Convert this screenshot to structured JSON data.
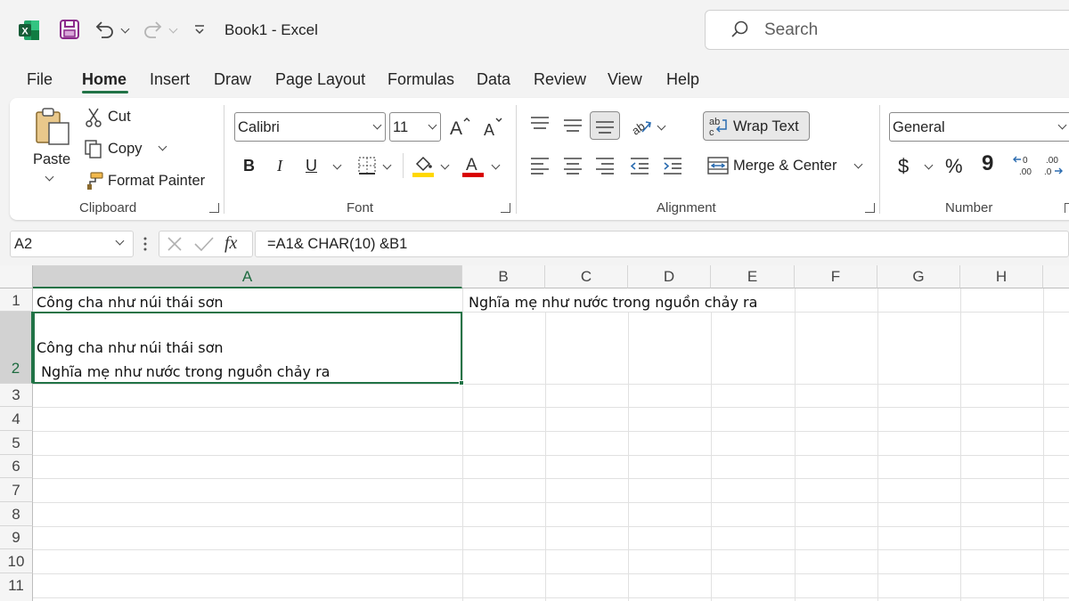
{
  "titlebar": {
    "title": "Book1  -  Excel",
    "search_placeholder": "Search",
    "icons": [
      "excel-logo-icon",
      "save-icon",
      "undo-icon",
      "redo-icon",
      "customize-qat-icon",
      "search-icon"
    ],
    "brand_color": "#217346"
  },
  "menu": {
    "tabs": [
      "File",
      "Home",
      "Insert",
      "Draw",
      "Page Layout",
      "Formulas",
      "Data",
      "Review",
      "View",
      "Help"
    ],
    "active": "Home"
  },
  "ribbon": {
    "clipboard": {
      "paste": "Paste",
      "cut": "Cut",
      "copy": "Copy",
      "format_painter": "Format Painter",
      "label": "Clipboard"
    },
    "font": {
      "family": "Calibri",
      "size": "11",
      "bold": "B",
      "italic": "I",
      "underline": "U",
      "label": "Font",
      "highlight_color": "#ffd800",
      "font_color": "#d90000"
    },
    "alignment": {
      "wrap_text": "Wrap Text",
      "merge_center": "Merge & Center",
      "label": "Alignment"
    },
    "number": {
      "format": "General",
      "currency": "$",
      "percent": "%",
      "comma": "9",
      "label": "Number"
    }
  },
  "formula_bar": {
    "name_box": "A2",
    "fx": "fx",
    "formula": "=A1& CHAR(10) &B1"
  },
  "sheet": {
    "columns": [
      "A",
      "B",
      "C",
      "D",
      "E",
      "F",
      "G",
      "H"
    ],
    "rows": [
      "1",
      "2",
      "3",
      "4",
      "5",
      "6",
      "7",
      "8",
      "9",
      "10",
      "11"
    ],
    "selected_cell": "A2",
    "cells": {
      "A1": "Công cha như núi thái sơn",
      "B1": "Nghĩa mẹ như nước trong nguồn chảy ra",
      "A2_line1": "Công cha như núi thái sơn",
      "A2_line2": " Nghĩa mẹ như nước trong nguồn chảy ra"
    }
  }
}
